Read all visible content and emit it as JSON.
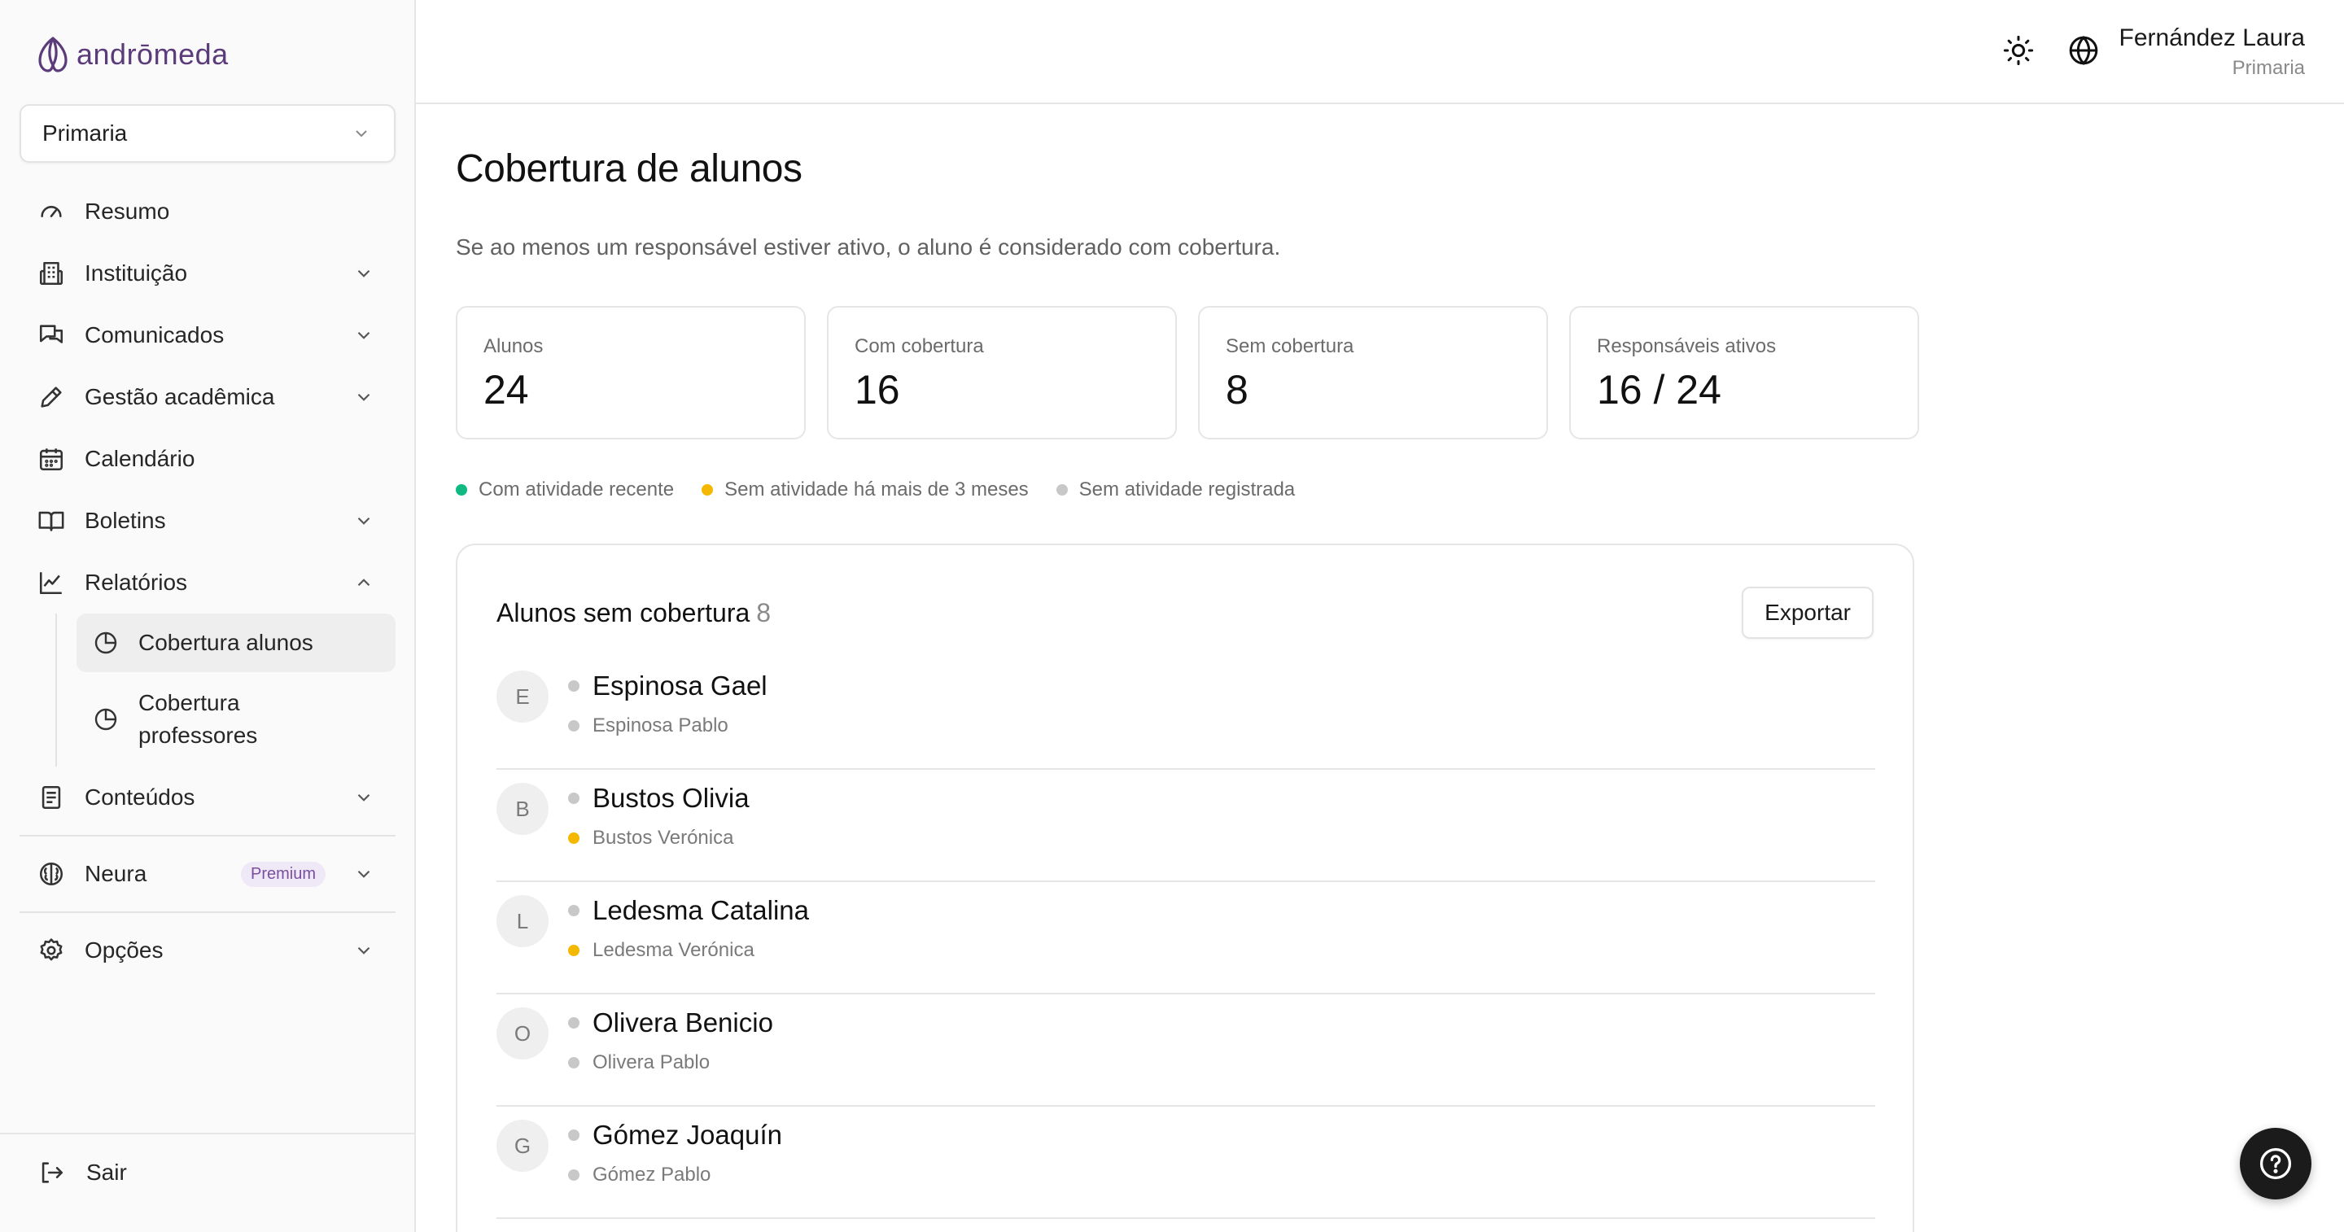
{
  "brand": {
    "name": "andrōmeda",
    "color": "#5b3b7a"
  },
  "level_selector": {
    "value": "Primaria"
  },
  "sidebar": {
    "items": [
      {
        "label": "Resumo",
        "icon": "gauge-icon"
      },
      {
        "label": "Instituição",
        "icon": "building-icon"
      },
      {
        "label": "Comunicados",
        "icon": "messages-icon"
      },
      {
        "label": "Gestão acadêmica",
        "icon": "pencil-icon"
      },
      {
        "label": "Calendário",
        "icon": "calendar-icon"
      },
      {
        "label": "Boletins",
        "icon": "book-icon"
      },
      {
        "label": "Relatórios",
        "icon": "chart-line-icon"
      },
      {
        "label": "Conteúdos",
        "icon": "document-icon"
      }
    ],
    "subitems": [
      {
        "label": "Cobertura alunos",
        "icon": "pie-chart-icon",
        "active": true
      },
      {
        "label_line1": "Cobertura",
        "label_line2": "professores",
        "icon": "pie-chart-icon",
        "active": false
      }
    ],
    "neura": {
      "label": "Neura",
      "badge": "Premium"
    },
    "options": {
      "label": "Opções"
    },
    "logout": {
      "label": "Sair"
    }
  },
  "header": {
    "theme_icon": "sun-icon",
    "language_icon": "globe-icon",
    "user": {
      "name": "Fernández Laura",
      "role": "Primaria"
    }
  },
  "page": {
    "title": "Cobertura de alunos",
    "subtitle": "Se ao menos um responsável estiver ativo, o aluno é considerado com cobertura."
  },
  "stats": [
    {
      "label": "Alunos",
      "value": "24"
    },
    {
      "label": "Com cobertura",
      "value": "16"
    },
    {
      "label": "Sem cobertura",
      "value": "8"
    },
    {
      "label": "Responsáveis ativos",
      "value": "16 / 24"
    }
  ],
  "legend": [
    {
      "label": "Com atividade recente",
      "color": "#10b981"
    },
    {
      "label": "Sem atividade há mais de 3 meses",
      "color": "#f5b800"
    },
    {
      "label": "Sem atividade registrada",
      "color": "#c8c8c8"
    }
  ],
  "table": {
    "title": "Alunos sem cobertura",
    "count": "8",
    "export_label": "Exportar",
    "rows": [
      {
        "initial": "E",
        "student": "Espinosa Gael",
        "student_status": "#c8c8c8",
        "guardian": "Espinosa Pablo",
        "guardian_status": "#c8c8c8"
      },
      {
        "initial": "B",
        "student": "Bustos Olivia",
        "student_status": "#c8c8c8",
        "guardian": "Bustos Verónica",
        "guardian_status": "#f5b800"
      },
      {
        "initial": "L",
        "student": "Ledesma Catalina",
        "student_status": "#c8c8c8",
        "guardian": "Ledesma Verónica",
        "guardian_status": "#f5b800"
      },
      {
        "initial": "O",
        "student": "Olivera Benicio",
        "student_status": "#c8c8c8",
        "guardian": "Olivera Pablo",
        "guardian_status": "#c8c8c8"
      },
      {
        "initial": "G",
        "student": "Gómez Joaquín",
        "student_status": "#c8c8c8",
        "guardian": "Gómez Pablo",
        "guardian_status": "#c8c8c8"
      }
    ]
  },
  "help": {
    "icon": "question-icon"
  }
}
